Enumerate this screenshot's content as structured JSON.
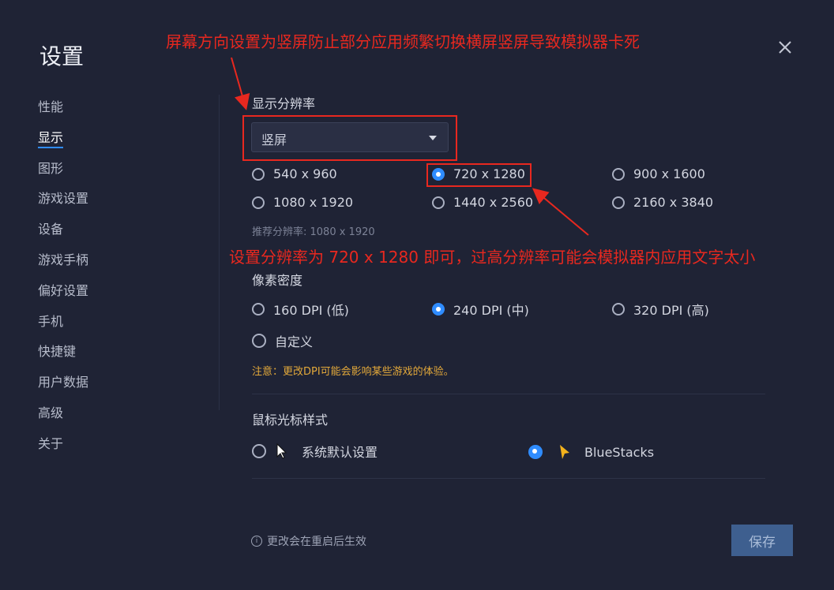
{
  "dialog": {
    "title": "设置"
  },
  "sidebar": {
    "items": [
      {
        "label": "性能"
      },
      {
        "label": "显示"
      },
      {
        "label": "图形"
      },
      {
        "label": "游戏设置"
      },
      {
        "label": "设备"
      },
      {
        "label": "游戏手柄"
      },
      {
        "label": "偏好设置"
      },
      {
        "label": "手机"
      },
      {
        "label": "快捷键"
      },
      {
        "label": "用户数据"
      },
      {
        "label": "高级"
      },
      {
        "label": "关于"
      }
    ],
    "active_index": 1
  },
  "resolution": {
    "label": "显示分辨率",
    "orientation_value": "竖屏",
    "options": [
      "540 x 960",
      "720 x 1280",
      "900 x 1600",
      "1080 x 1920",
      "1440 x 2560",
      "2160 x 3840"
    ],
    "selected": "720 x 1280",
    "recommended": "推荐分辨率: 1080 x 1920"
  },
  "dpi": {
    "label": "像素密度",
    "options": [
      "160 DPI (低)",
      "240 DPI (中)",
      "320 DPI (高)",
      "自定义"
    ],
    "selected": "240 DPI (中)",
    "notice": "注意：更改DPI可能会影响某些游戏的体验。"
  },
  "cursor": {
    "label": "鼠标光标样式",
    "options": [
      "系统默认设置",
      "BlueStacks"
    ],
    "selected": "BlueStacks"
  },
  "footer": {
    "note": "更改会在重启后生效",
    "save_label": "保存"
  },
  "annotations": {
    "top": "屏幕方向设置为竖屏防止部分应用频繁切换横屏竖屏导致模拟器卡死",
    "middle": "设置分辨率为 720 x 1280 即可，过高分辨率可能会模拟器内应用文字太小"
  },
  "colors": {
    "background": "#1f2335",
    "accent": "#2f8cff",
    "annotation": "#e8281f",
    "notice": "#e2a83a"
  }
}
